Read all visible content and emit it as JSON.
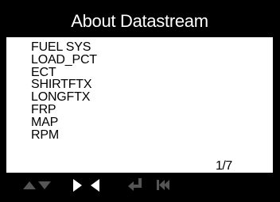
{
  "title": "About Datastream",
  "items": [
    {
      "label": "FUEL SYS"
    },
    {
      "label": "LOAD_PCT"
    },
    {
      "label": "ECT"
    },
    {
      "label": "SHIRTFTX"
    },
    {
      "label": "LONGFTX"
    },
    {
      "label": "FRP"
    },
    {
      "label": "MAP"
    },
    {
      "label": "RPM"
    }
  ],
  "page_indicator": "1/7",
  "toolbar": {
    "icons": [
      "up-arrow-icon",
      "down-arrow-icon",
      "right-arrow-icon",
      "left-arrow-icon",
      "enter-icon",
      "skip-back-icon"
    ]
  },
  "colors": {
    "background": "#000000",
    "screen": "#ffffff",
    "icon_dim": "#555555",
    "icon_active": "#ffffff"
  }
}
